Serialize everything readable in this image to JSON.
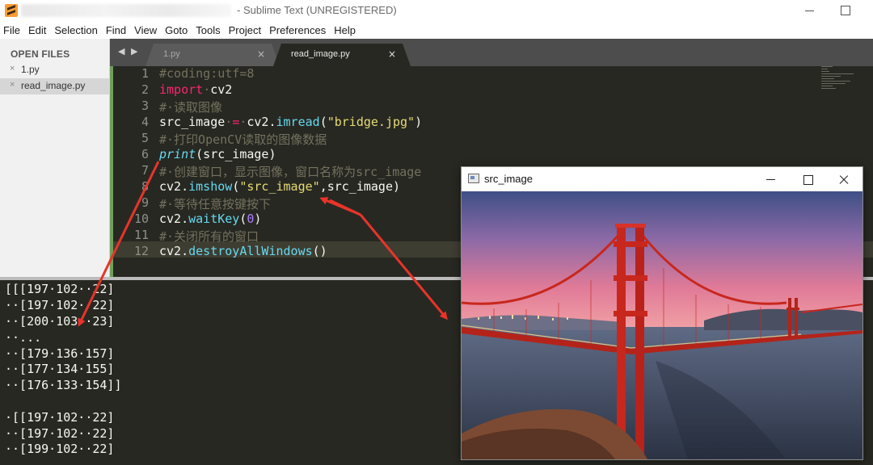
{
  "window": {
    "title": "- Sublime Text (UNREGISTERED)"
  },
  "menu": {
    "items": [
      "File",
      "Edit",
      "Selection",
      "Find",
      "View",
      "Goto",
      "Tools",
      "Project",
      "Preferences",
      "Help"
    ]
  },
  "sidebar": {
    "header": "OPEN FILES",
    "files": [
      {
        "name": "1.py",
        "close": "×"
      },
      {
        "name": "read_image.py",
        "close": "×"
      }
    ]
  },
  "tabs": [
    {
      "label": "1.py",
      "close": "×"
    },
    {
      "label": "read_image.py",
      "close": "×"
    }
  ],
  "nav_arrows": "◀ ▶",
  "editor": {
    "line_numbers": [
      "1",
      "2",
      "3",
      "4",
      "5",
      "6",
      "7",
      "8",
      "9",
      "10",
      "11",
      "12"
    ],
    "current_line": "12",
    "lines": [
      "#coding:utf=8",
      "import·cv2",
      "#·读取图像",
      "src_image·=·cv2.imread(\"bridge.jpg\")",
      "#·打印OpenCV读取的图像数据",
      "print(src_image)",
      "#·创建窗口，显示图像，窗口名称为src_image",
      "cv2.imshow(\"src_image\",src_image)",
      "#·等待任意按键按下",
      "cv2.waitKey(0)",
      "#·关闭所有的窗口",
      "cv2.destroyAllWindows()"
    ]
  },
  "console": {
    "lines": [
      "[[[197·102··22]",
      "··[197·102··22]",
      "··[200·103··23]",
      "··...",
      "··[179·136·157]",
      "··[177·134·155]",
      "··[176·133·154]]",
      "",
      "·[[197·102··22]",
      "··[197·102··22]",
      "··[199·102··22]"
    ]
  },
  "image_window": {
    "title": "src_image",
    "image": "golden-gate-bridge-photo"
  },
  "annotation_color": "#e8342a",
  "theme": {
    "editor_bg": "#272822",
    "comment": "#75715e",
    "keyword": "#f92672",
    "function": "#66d9ef",
    "string": "#e6db74",
    "number": "#ae81ff"
  }
}
